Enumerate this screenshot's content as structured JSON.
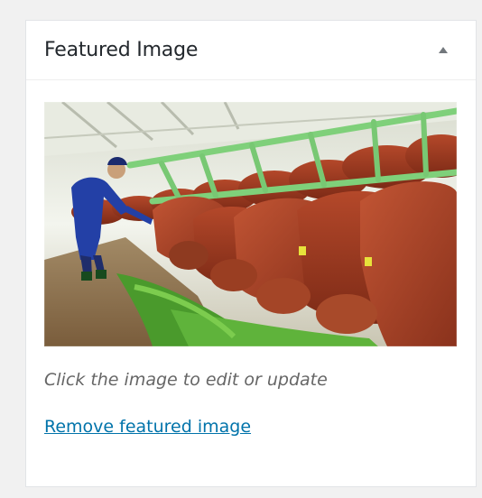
{
  "metabox": {
    "title": "Featured Image",
    "toggle_icon": "triangle-up-icon"
  },
  "featured_image": {
    "subject": "cattle-feeding-photo"
  },
  "hint_text": "Click the image to edit or update",
  "remove_link": "Remove featured image",
  "colors": {
    "link": "#0073aa",
    "title": "#23282d",
    "hint": "#666666"
  }
}
